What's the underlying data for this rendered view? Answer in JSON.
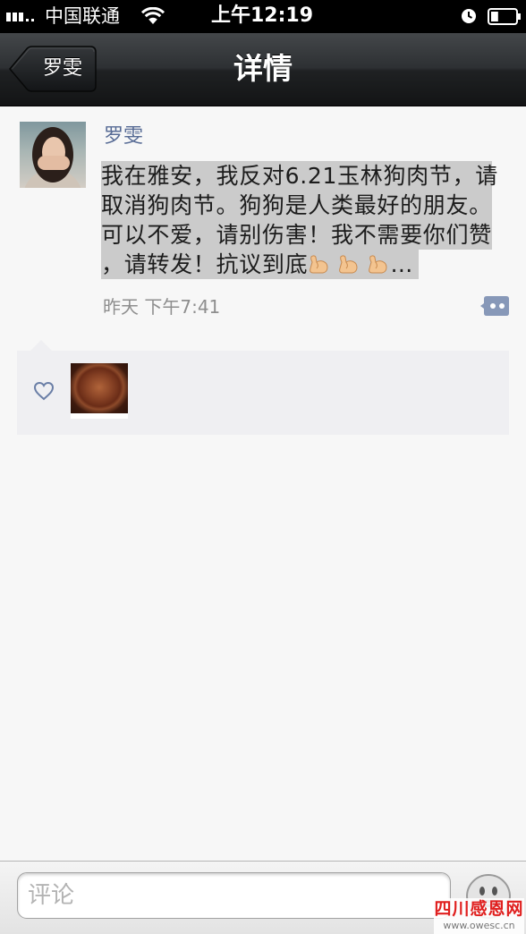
{
  "status_bar": {
    "carrier": "中国联通",
    "time": "上午12:19",
    "battery_level": 0.3,
    "icons": [
      "signal-icon",
      "wifi-icon",
      "alarm-clock-icon",
      "battery-icon"
    ]
  },
  "nav": {
    "back_label": "罗雯",
    "title": "详情"
  },
  "post": {
    "author": "罗雯",
    "text_lines": [
      "我在雅安，我反对6.21玉林狗肉节，请",
      "取消狗肉节。狗狗是人类最好的朋友。",
      "可以不爱，请别伤害！我不需要你们赞"
    ],
    "last_line": {
      "text": "，请转发！抗议到底",
      "emoji_icons": [
        "flexed-biceps-icon",
        "flexed-biceps-icon",
        "flexed-biceps-icon"
      ],
      "tail": "…"
    },
    "timestamp": "昨天 下午7:41",
    "comment_button_icon": "comment-bubble-icon"
  },
  "likes": {
    "icon": "heart-icon"
  },
  "comment_bar": {
    "placeholder": "评论",
    "emoji_button_icon": "smiley-face-icon"
  },
  "watermark": {
    "title": "四川感恩网",
    "url": "www.owesc.cn"
  },
  "colors": {
    "link_blue": "#576b95",
    "selection_highlight": "#cbcbcb",
    "comment_button": "#8798b8",
    "likes_background": "#efeff2",
    "watermark_red": "#e0201f"
  }
}
